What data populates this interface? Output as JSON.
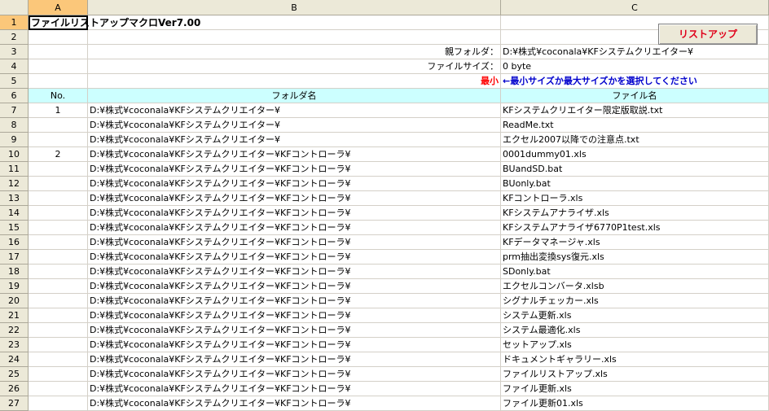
{
  "columns": [
    "A",
    "B",
    "C"
  ],
  "title": "ファイルリストアップマクロVer7.00",
  "button_label": "リストアップ",
  "labels": {
    "parent_folder_label": "親フォルダ：",
    "parent_folder_value": "D:¥株式¥coconala¥KFシステムクリエイター¥",
    "file_size_label": "ファイルサイズ：",
    "file_size_value": "0  byte",
    "size_mode": "最小",
    "size_hint": "←最小サイズか最大サイズかを選択してください"
  },
  "table_headers": {
    "no": "No.",
    "folder": "フォルダ名",
    "file": "ファイル名"
  },
  "rows": [
    {
      "row": "7",
      "no": "1",
      "folder": "D:¥株式¥coconala¥KFシステムクリエイター¥",
      "file": "KFシステムクリエイター限定版取説.txt"
    },
    {
      "row": "8",
      "no": "",
      "folder": "D:¥株式¥coconala¥KFシステムクリエイター¥",
      "file": "ReadMe.txt"
    },
    {
      "row": "9",
      "no": "",
      "folder": "D:¥株式¥coconala¥KFシステムクリエイター¥",
      "file": "エクセル2007以降での注意点.txt"
    },
    {
      "row": "10",
      "no": "2",
      "folder": "D:¥株式¥coconala¥KFシステムクリエイター¥KFコントローラ¥",
      "file": "0001dummy01.xls"
    },
    {
      "row": "11",
      "no": "",
      "folder": "D:¥株式¥coconala¥KFシステムクリエイター¥KFコントローラ¥",
      "file": "BUandSD.bat"
    },
    {
      "row": "12",
      "no": "",
      "folder": "D:¥株式¥coconala¥KFシステムクリエイター¥KFコントローラ¥",
      "file": "BUonly.bat"
    },
    {
      "row": "13",
      "no": "",
      "folder": "D:¥株式¥coconala¥KFシステムクリエイター¥KFコントローラ¥",
      "file": "KFコントローラ.xls"
    },
    {
      "row": "14",
      "no": "",
      "folder": "D:¥株式¥coconala¥KFシステムクリエイター¥KFコントローラ¥",
      "file": "KFシステムアナライザ.xls"
    },
    {
      "row": "15",
      "no": "",
      "folder": "D:¥株式¥coconala¥KFシステムクリエイター¥KFコントローラ¥",
      "file": "KFシステムアナライザ6770P1test.xls"
    },
    {
      "row": "16",
      "no": "",
      "folder": "D:¥株式¥coconala¥KFシステムクリエイター¥KFコントローラ¥",
      "file": "KFデータマネージャ.xls"
    },
    {
      "row": "17",
      "no": "",
      "folder": "D:¥株式¥coconala¥KFシステムクリエイター¥KFコントローラ¥",
      "file": "prm抽出変換sys復元.xls"
    },
    {
      "row": "18",
      "no": "",
      "folder": "D:¥株式¥coconala¥KFシステムクリエイター¥KFコントローラ¥",
      "file": "SDonly.bat"
    },
    {
      "row": "19",
      "no": "",
      "folder": "D:¥株式¥coconala¥KFシステムクリエイター¥KFコントローラ¥",
      "file": "エクセルコンバータ.xlsb"
    },
    {
      "row": "20",
      "no": "",
      "folder": "D:¥株式¥coconala¥KFシステムクリエイター¥KFコントローラ¥",
      "file": "シグナルチェッカー.xls"
    },
    {
      "row": "21",
      "no": "",
      "folder": "D:¥株式¥coconala¥KFシステムクリエイター¥KFコントローラ¥",
      "file": "システム更新.xls"
    },
    {
      "row": "22",
      "no": "",
      "folder": "D:¥株式¥coconala¥KFシステムクリエイター¥KFコントローラ¥",
      "file": "システム最適化.xls"
    },
    {
      "row": "23",
      "no": "",
      "folder": "D:¥株式¥coconala¥KFシステムクリエイター¥KFコントローラ¥",
      "file": "セットアップ.xls"
    },
    {
      "row": "24",
      "no": "",
      "folder": "D:¥株式¥coconala¥KFシステムクリエイター¥KFコントローラ¥",
      "file": "ドキュメントギャラリー.xls"
    },
    {
      "row": "25",
      "no": "",
      "folder": "D:¥株式¥coconala¥KFシステムクリエイター¥KFコントローラ¥",
      "file": "ファイルリストアップ.xls"
    },
    {
      "row": "26",
      "no": "",
      "folder": "D:¥株式¥coconala¥KFシステムクリエイター¥KFコントローラ¥",
      "file": "ファイル更新.xls"
    },
    {
      "row": "27",
      "no": "",
      "folder": "D:¥株式¥coconala¥KFシステムクリエイター¥KFコントローラ¥",
      "file": "ファイル更新01.xls"
    }
  ],
  "colors": {
    "header_fill": "#ccffff",
    "selected_header": "#fbc77a",
    "accent_red": "#ff0000",
    "accent_blue": "#0000cc"
  }
}
